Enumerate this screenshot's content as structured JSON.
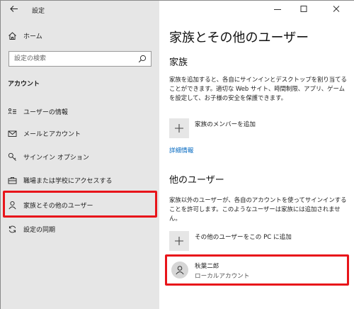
{
  "window": {
    "title": "設定"
  },
  "sidebar": {
    "home_label": "ホーム",
    "search_placeholder": "設定の検索",
    "section_heading": "アカウント",
    "items": [
      {
        "label": "ユーザーの情報",
        "icon": "user-info-icon"
      },
      {
        "label": "メールとアカウント",
        "icon": "mail-icon"
      },
      {
        "label": "サインイン オプション",
        "icon": "key-icon"
      },
      {
        "label": "職場または学校にアクセスする",
        "icon": "briefcase-icon"
      },
      {
        "label": "家族とその他のユーザー",
        "icon": "person-icon",
        "selected": true
      },
      {
        "label": "設定の同期",
        "icon": "sync-icon"
      }
    ]
  },
  "main": {
    "title": "家族とその他のユーザー",
    "family": {
      "heading": "家族",
      "description": "家族を追加すると、各自にサインインとデスクトップを割り当てることができます。適切な Web サイト、時間制限、アプリ、ゲームを設定して、お子様の安全を保護できます。",
      "add_label": "家族のメンバーを追加",
      "link": "詳細情報"
    },
    "others": {
      "heading": "他のユーザー",
      "description": "家族以外のユーザーが、各自のアカウントを使ってサインインすることを許可します。このようなユーザーは家族には追加されません。",
      "add_label": "その他のユーザーをこの PC に追加",
      "user": {
        "name": "秋葉二郎",
        "type": "ローカルアカウント"
      }
    }
  },
  "colors": {
    "sidebar_bg": "#e6e6e6",
    "highlight": "#e8141a",
    "link": "#0067c0"
  }
}
